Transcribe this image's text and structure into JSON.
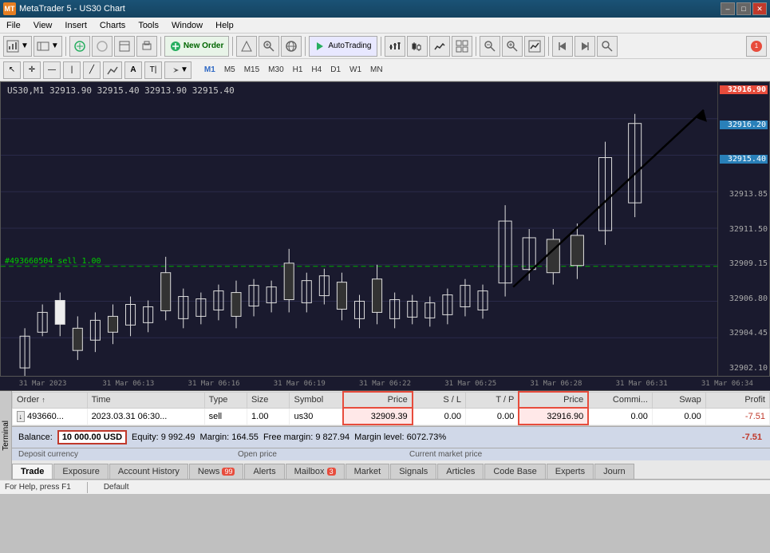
{
  "titleBar": {
    "title": "MetaTrader 5 - US30 Chart",
    "minimizeLabel": "–",
    "maximizeLabel": "□",
    "closeLabel": "✕"
  },
  "menuBar": {
    "items": [
      "File",
      "View",
      "Insert",
      "Charts",
      "Tools",
      "Window",
      "Help"
    ]
  },
  "toolbar": {
    "newOrderLabel": "New Order",
    "autoTradingLabel": "AutoTrading",
    "badge": "1"
  },
  "timeframes": {
    "items": [
      "M1",
      "M5",
      "M15",
      "M30",
      "H1",
      "H4",
      "D1",
      "W1",
      "MN"
    ],
    "active": "M1"
  },
  "chart": {
    "title": "US30,M1  32913.90 32915.40 32913.90 32915.40",
    "prices": {
      "current": "32916.90",
      "line1": "32916.20",
      "line2": "32915.40",
      "p3": "32913.85",
      "p4": "32911.50",
      "p5": "32909.15",
      "p6": "32906.80",
      "p7": "32904.45",
      "p8": "32902.10"
    },
    "tradeLabel": "#493660504 sell 1.00",
    "tradeLine": "32909.15"
  },
  "timeAxis": {
    "labels": [
      "31 Mar 2023",
      "31 Mar 06:13",
      "31 Mar 06:16",
      "31 Mar 06:19",
      "31 Mar 06:22",
      "31 Mar 06:25",
      "31 Mar 06:28",
      "31 Mar 06:31",
      "31 Mar 06:34"
    ]
  },
  "terminal": {
    "sideLabel": "Terminal",
    "tabs": [
      {
        "label": "Trade",
        "active": true,
        "badge": ""
      },
      {
        "label": "Exposure",
        "active": false,
        "badge": ""
      },
      {
        "label": "Account History",
        "active": false,
        "badge": ""
      },
      {
        "label": "News",
        "active": false,
        "badge": "99"
      },
      {
        "label": "Alerts",
        "active": false,
        "badge": ""
      },
      {
        "label": "Mailbox",
        "active": false,
        "badge": "3"
      },
      {
        "label": "Market",
        "active": false,
        "badge": ""
      },
      {
        "label": "Signals",
        "active": false,
        "badge": ""
      },
      {
        "label": "Articles",
        "active": false,
        "badge": ""
      },
      {
        "label": "Code Base",
        "active": false,
        "badge": ""
      },
      {
        "label": "Experts",
        "active": false,
        "badge": ""
      },
      {
        "label": "Journ",
        "active": false,
        "badge": ""
      }
    ],
    "tableHeaders": [
      "Order",
      "Time",
      "Type",
      "Size",
      "Symbol",
      "Price",
      "S / L",
      "T / P",
      "Price",
      "Commi...",
      "Swap",
      "Profit"
    ],
    "tradeRow": {
      "order": "493660...",
      "time": "2023.03.31 06:30...",
      "type": "sell",
      "size": "1.00",
      "symbol": "us30",
      "openPrice": "32909.39",
      "sl": "0.00",
      "tp": "0.00",
      "currentPrice": "32916.90",
      "commission": "0.00",
      "swap": "0.00",
      "profit": "-7.51"
    },
    "balanceRow": {
      "balanceLabel": "Balance:",
      "balanceValue": "10 000.00 USD",
      "equity": "Equity: 9 992.49",
      "margin": "Margin: 164.55",
      "freeMargin": "Free margin: 9 827.94",
      "marginLevel": "Margin level: 6072.73%",
      "totalProfit": "-7.51"
    },
    "labels": {
      "depositCurrency": "Deposit currency",
      "openPrice": "Open price",
      "marketPrice": "Current market price"
    }
  },
  "statusBar": {
    "help": "For Help, press F1",
    "default": "Default"
  }
}
